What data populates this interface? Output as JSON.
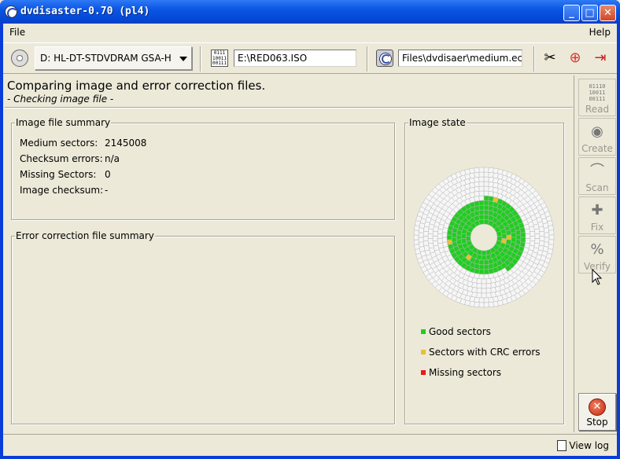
{
  "window": {
    "title": "dvdisaster-0.70 (pl4)"
  },
  "menu": {
    "file": "File",
    "help": "Help"
  },
  "toolbar": {
    "drive": "D: HL-DT-STDVDRAM GSA-H",
    "image_path": "E:\\RED063.ISO",
    "ecc_path": "Files\\dvdisaer\\medium.ecc"
  },
  "status": {
    "heading": "Comparing image and error correction files.",
    "subheading": "- Checking image file -"
  },
  "image_summary": {
    "title": "Image file summary",
    "rows": [
      {
        "key": "Medium sectors:",
        "value": "2145008"
      },
      {
        "key": "Checksum errors:",
        "value": "n/a"
      },
      {
        "key": "Missing Sectors:",
        "value": "0"
      },
      {
        "key": "Image checksum:",
        "value": "-"
      }
    ]
  },
  "ecc_summary": {
    "title": "Error correction file summary"
  },
  "image_state": {
    "title": "Image state",
    "legend": [
      {
        "label": "Good sectors",
        "color": "#22cc22"
      },
      {
        "label": "Sectors with CRC errors",
        "color": "#e8c030"
      },
      {
        "label": "Missing sectors",
        "color": "#e81818"
      }
    ],
    "progress": 0.45
  },
  "sidebar": {
    "read": "Read",
    "read_icon_text": "01110\n10011\n00111",
    "create": "Create",
    "scan": "Scan",
    "fix": "Fix",
    "verify": "Verify",
    "stop": "Stop"
  },
  "statusbar": {
    "view_log": "View log"
  },
  "icons": {
    "bin_text": "0111\n10011\n00111"
  }
}
